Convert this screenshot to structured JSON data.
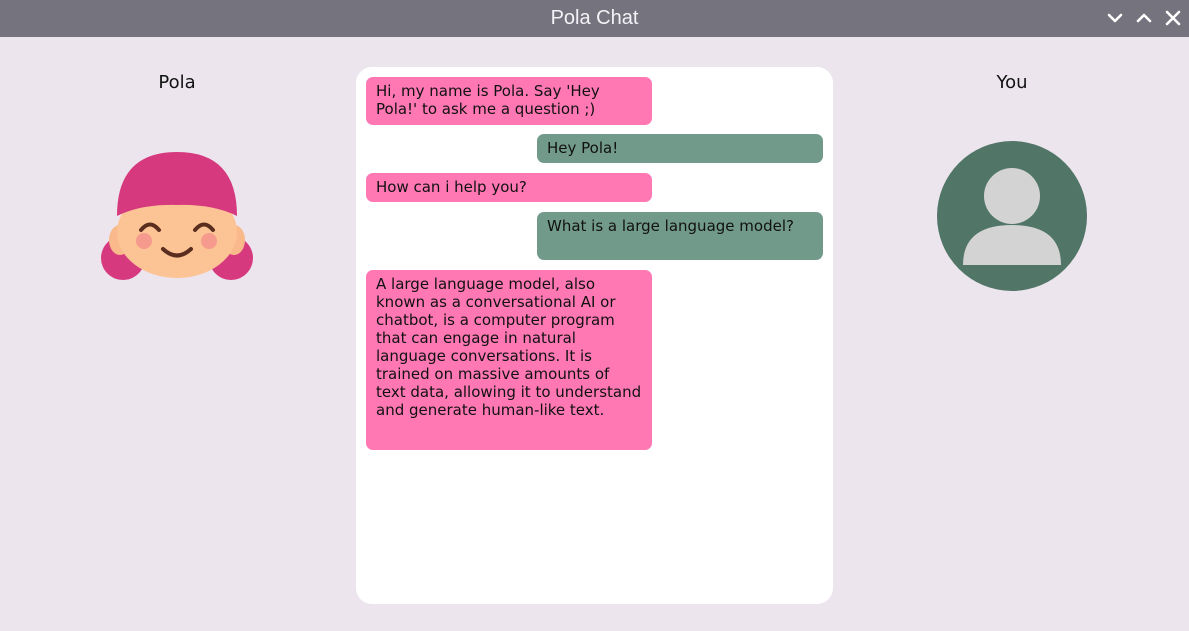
{
  "window": {
    "title": "Pola Chat",
    "controls": [
      "minimize",
      "maximize",
      "close"
    ]
  },
  "left_panel": {
    "label": "Pola",
    "avatar_icon": "girl-face-icon"
  },
  "right_panel": {
    "label": "You",
    "avatar_icon": "user-silhouette-icon"
  },
  "chat": {
    "messages": [
      {
        "sender": "pola",
        "text": "Hi, my name is Pola. Say 'Hey Pola!' to ask me a question ;)"
      },
      {
        "sender": "user",
        "text": "Hey Pola!"
      },
      {
        "sender": "pola",
        "text": "How can i help you?"
      },
      {
        "sender": "user",
        "text": " What is a large language model?"
      },
      {
        "sender": "pola",
        "text": "A large language model, also known as a conversational AI or chatbot, is a computer program that can engage in natural language conversations. It is trained on massive amounts of text data, allowing it to understand and generate human-like text."
      }
    ]
  },
  "colors": {
    "titlebar": "#75737d",
    "background": "#ece5ee",
    "pola_bubble": "#ff78b4",
    "user_bubble": "#729a8b",
    "user_avatar_bg": "#517567",
    "pola_hair": "#d6397e"
  }
}
